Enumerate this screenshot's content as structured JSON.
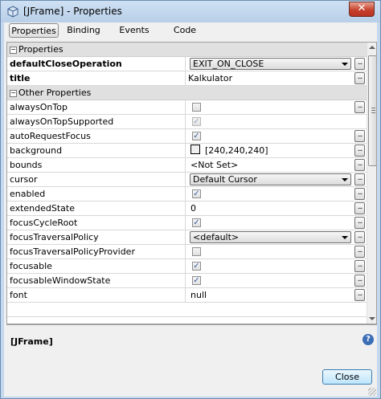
{
  "window": {
    "title": "[JFrame] - Properties",
    "close_glyph": "✕"
  },
  "tabs": [
    "Properties",
    "Binding",
    "Events",
    "Code"
  ],
  "categories": {
    "properties": "Properties",
    "other": "Other Properties"
  },
  "main_props": [
    {
      "name": "defaultCloseOperation",
      "value": "EXIT_ON_CLOSE",
      "editor": "combo"
    },
    {
      "name": "title",
      "value": "Kalkulator",
      "editor": "text"
    }
  ],
  "other_props": [
    {
      "name": "alwaysOnTop",
      "checked": false,
      "disabled": false
    },
    {
      "name": "alwaysOnTopSupported",
      "checked": true,
      "disabled": true
    },
    {
      "name": "autoRequestFocus",
      "checked": true,
      "disabled": false
    },
    {
      "name": "background",
      "value": "[240,240,240]"
    },
    {
      "name": "bounds",
      "value": "<Not Set>"
    },
    {
      "name": "cursor",
      "value": "Default Cursor"
    },
    {
      "name": "enabled",
      "checked": true,
      "disabled": false
    },
    {
      "name": "extendedState",
      "value": "0"
    },
    {
      "name": "focusCycleRoot",
      "checked": true,
      "disabled": false
    },
    {
      "name": "focusTraversalPolicy",
      "value": "<default>"
    },
    {
      "name": "focusTraversalPolicyProvider",
      "checked": false,
      "disabled": false
    },
    {
      "name": "focusable",
      "checked": true,
      "disabled": false
    },
    {
      "name": "focusableWindowState",
      "checked": true,
      "disabled": false
    },
    {
      "name": "font",
      "value": "null"
    }
  ],
  "description": {
    "title": "[JFrame]",
    "help_glyph": "?"
  },
  "buttons": {
    "close": "Close",
    "ellipsis": "..."
  },
  "colors": {
    "swatch": "#f0f0f0",
    "accent": "#3a6db5"
  }
}
